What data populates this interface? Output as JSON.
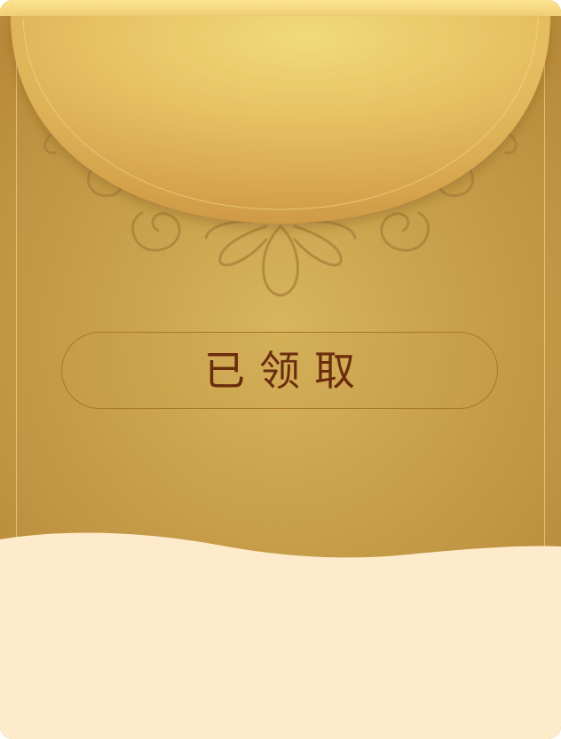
{
  "envelope": {
    "status_label": "已领取",
    "colors": {
      "envelope_body": "#c9a04c",
      "flap_gold": "#efd57a",
      "button_border": "#a9762a",
      "label_text": "#6b2c0e",
      "bottom_cream": "#fdebcb"
    }
  }
}
